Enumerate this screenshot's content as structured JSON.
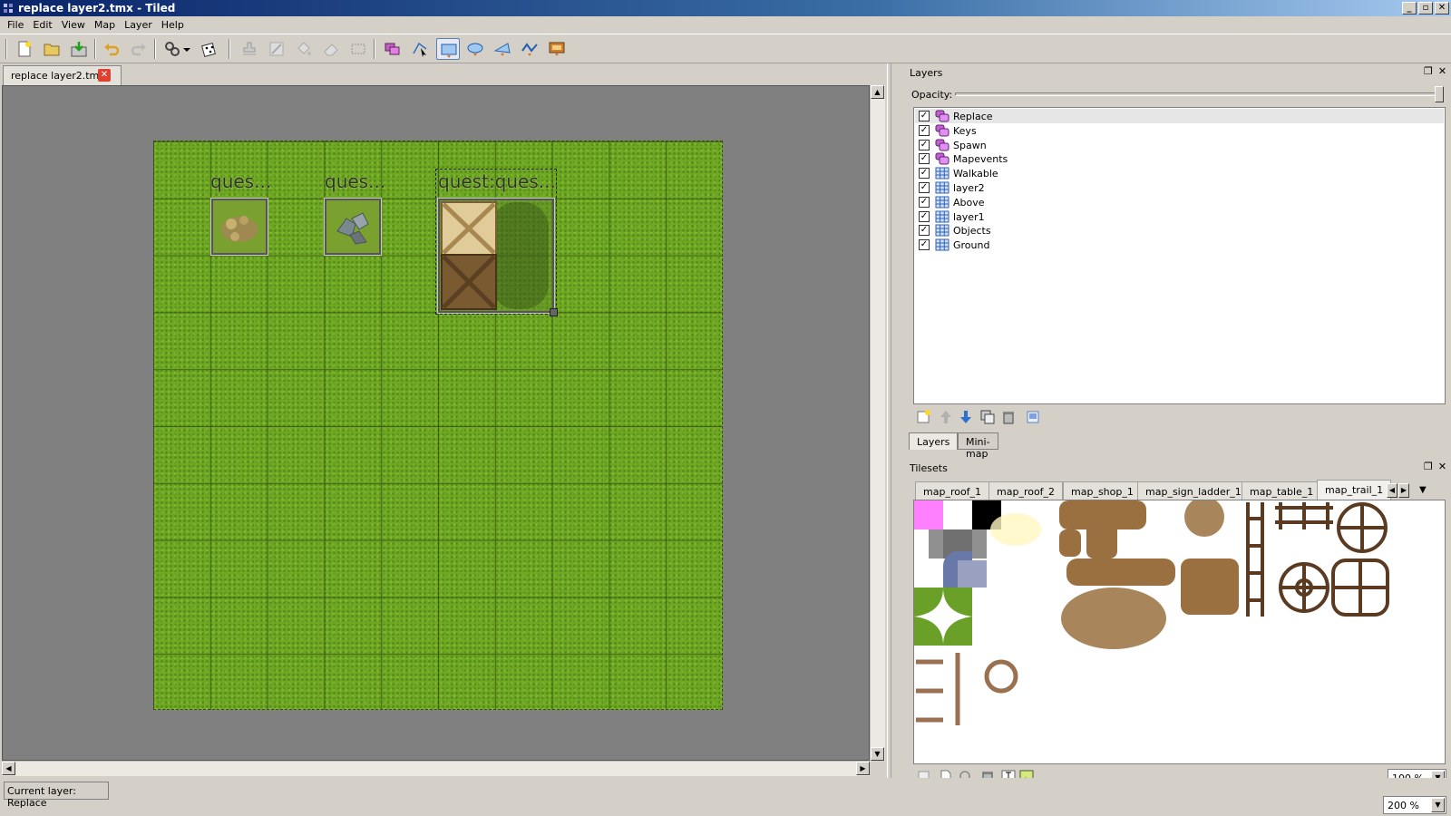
{
  "window": {
    "title": "replace layer2.tmx - Tiled"
  },
  "menu": [
    "File",
    "Edit",
    "View",
    "Map",
    "Layer",
    "Help"
  ],
  "document_tab": {
    "label": "replace layer2.tmx"
  },
  "map_objects": [
    {
      "label": "ques..."
    },
    {
      "label": "ques..."
    },
    {
      "label": "quest:ques..."
    }
  ],
  "layers_panel": {
    "title": "Layers",
    "opacity_label": "Opacity:",
    "opacity": 1.0,
    "layers": [
      {
        "name": "Replace",
        "type": "object",
        "visible": true,
        "selected": true
      },
      {
        "name": "Keys",
        "type": "object",
        "visible": true
      },
      {
        "name": "Spawn",
        "type": "object",
        "visible": true
      },
      {
        "name": "Mapevents",
        "type": "object",
        "visible": true
      },
      {
        "name": "Walkable",
        "type": "tile",
        "visible": true
      },
      {
        "name": "layer2",
        "type": "tile",
        "visible": true
      },
      {
        "name": "Above",
        "type": "tile",
        "visible": true
      },
      {
        "name": "layer1",
        "type": "tile",
        "visible": true
      },
      {
        "name": "Objects",
        "type": "tile",
        "visible": true
      },
      {
        "name": "Ground",
        "type": "tile",
        "visible": true
      }
    ],
    "tabs": [
      "Layers",
      "Mini-map"
    ]
  },
  "tilesets_panel": {
    "title": "Tilesets",
    "tabs": [
      "map_roof_1",
      "map_roof_2",
      "map_shop_1",
      "map_sign_ladder_1",
      "map_table_1",
      "map_trail_1"
    ],
    "active_tab": "map_trail_1",
    "zoom": "100 %"
  },
  "statusbar": {
    "current_layer": "Current layer: Replace",
    "zoom": "200 %"
  },
  "colors": {
    "grass": "#6fa822",
    "canvas_bg": "#808080",
    "chrome": "#d4d0c8",
    "titlebar": "#0a246a"
  }
}
